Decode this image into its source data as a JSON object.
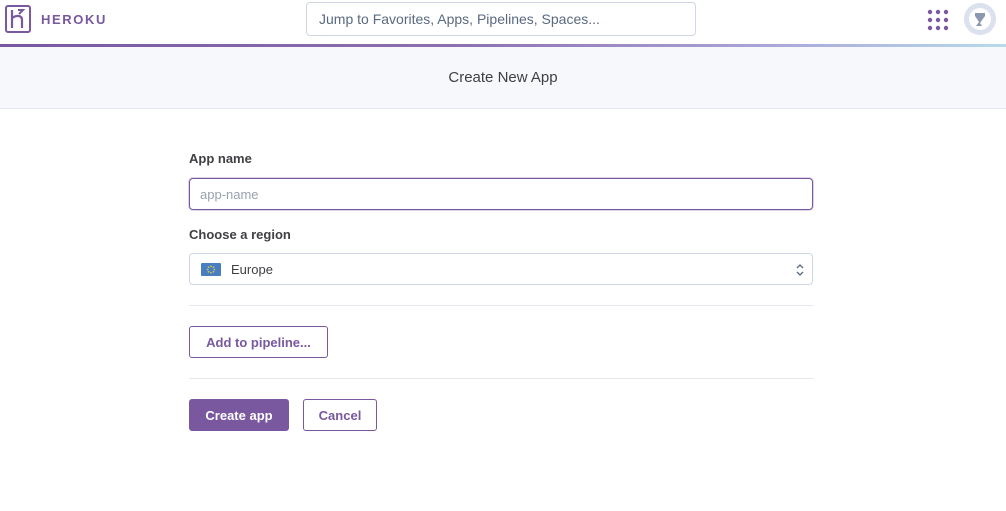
{
  "topnav": {
    "brand": "HEROKU",
    "search_placeholder": "Jump to Favorites, Apps, Pipelines, Spaces...",
    "icons": {
      "logo": "heroku-logo-icon",
      "apps": "apps-grid-icon",
      "avatar": "user-avatar-icon"
    },
    "colors": {
      "brand": "#79589f"
    }
  },
  "header": {
    "title": "Create New App"
  },
  "form": {
    "app_name_label": "App name",
    "app_name_value": "",
    "app_name_placeholder": "app-name",
    "region_label": "Choose a region",
    "region_value": "Europe",
    "region_flag_icon": "eu-flag-icon",
    "add_pipeline_label": "Add to pipeline...",
    "create_label": "Create app",
    "cancel_label": "Cancel"
  }
}
